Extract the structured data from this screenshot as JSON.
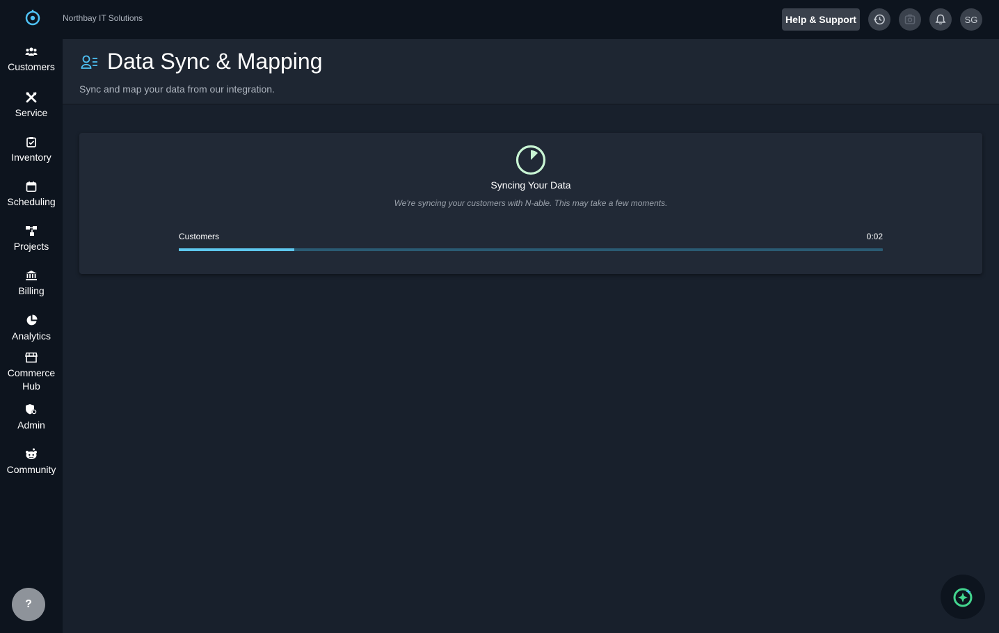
{
  "topbar": {
    "org_name": "Northbay IT Solutions",
    "help_label": "Help & Support",
    "icons": [
      "history-icon",
      "screenshot-icon",
      "bell-icon"
    ],
    "avatar_initials": "SG"
  },
  "sidebar": {
    "items": [
      {
        "label": "Customers",
        "icon": "users-icon"
      },
      {
        "label": "Service",
        "icon": "tools-icon"
      },
      {
        "label": "Inventory",
        "icon": "clipboard-check-icon"
      },
      {
        "label": "Scheduling",
        "icon": "calendar-icon"
      },
      {
        "label": "Projects",
        "icon": "project-diagram-icon"
      },
      {
        "label": "Billing",
        "icon": "bank-icon"
      },
      {
        "label": "Analytics",
        "icon": "pie-chart-icon"
      },
      {
        "label": "Commerce Hub",
        "icon": "store-icon"
      },
      {
        "label": "Admin",
        "icon": "shield-gear-icon"
      },
      {
        "label": "Community",
        "icon": "community-icon"
      }
    ],
    "help_glyph": "?"
  },
  "page": {
    "title": "Data Sync & Mapping",
    "subtitle": "Sync and map your data from our integration."
  },
  "sync": {
    "title": "Syncing Your Data",
    "description": "We're syncing your customers with N-able. This may take a few moments.",
    "progress_label": "Customers",
    "elapsed": "0:02",
    "progress_fraction": 0.164
  },
  "colors": {
    "accent": "#5ec7ee",
    "track": "#2a5a73",
    "sync_icon": "#c9f5d4",
    "fab_green": "#43d68f"
  }
}
